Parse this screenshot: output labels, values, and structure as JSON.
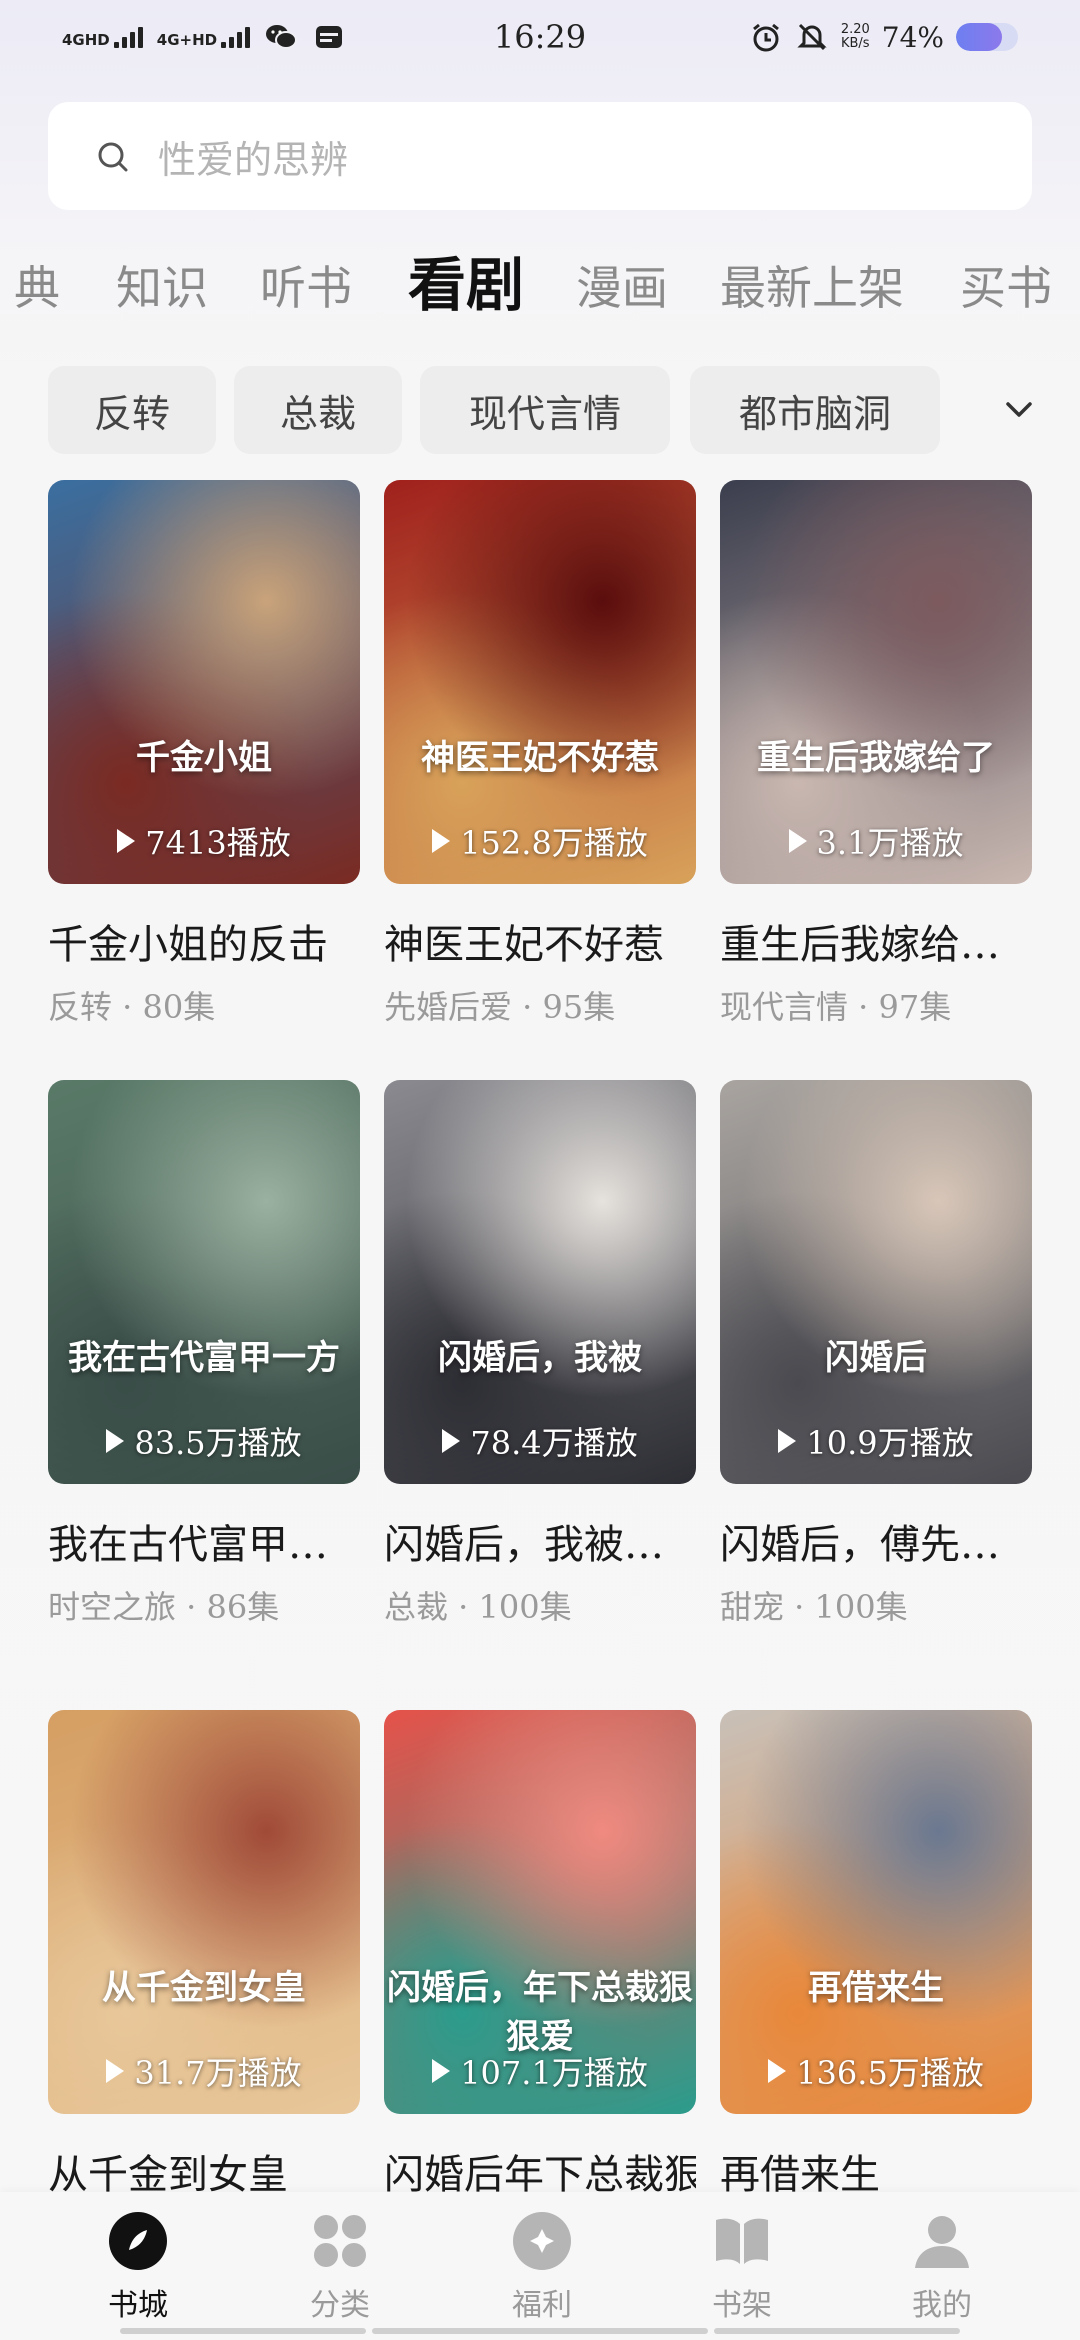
{
  "status_bar": {
    "time": "16:29",
    "network1": "4GHD",
    "network2": "4G+HD",
    "speed_value": "2.20",
    "speed_unit": "KB/s",
    "battery_percent": "74%",
    "battery_level": 0.74
  },
  "search": {
    "placeholder": "性爱的思辨"
  },
  "tabs": [
    {
      "label": "典"
    },
    {
      "label": "知识"
    },
    {
      "label": "听书"
    },
    {
      "label": "看剧",
      "active": true
    },
    {
      "label": "漫画"
    },
    {
      "label": "最新上架"
    },
    {
      "label": "买书"
    }
  ],
  "filters": [
    {
      "label": "反转"
    },
    {
      "label": "总裁"
    },
    {
      "label": "现代言情"
    },
    {
      "label": "都市脑洞"
    }
  ],
  "cards": [
    {
      "title": "千金小姐的反击",
      "meta": "反转 · 80集",
      "plays": "7413播放",
      "poster_text": "千金小姐",
      "colors": [
        "#3a6fa0",
        "#c9a37a",
        "#7a2a22"
      ]
    },
    {
      "title": "神医王妃不好惹",
      "meta": "先婚后爱 · 95集",
      "plays": "152.8万播放",
      "poster_text": "神医王妃不好惹",
      "colors": [
        "#a0201c",
        "#5a0d0d",
        "#d8a25a"
      ]
    },
    {
      "title": "重生后我嫁给…",
      "meta": "现代言情 · 97集",
      "plays": "3.1万播放",
      "poster_text": "重生后我嫁给了",
      "colors": [
        "#3b3e4e",
        "#7c5a5e",
        "#c9b7b0"
      ]
    },
    {
      "title": "我在古代富甲…",
      "meta": "时空之旅 · 86集",
      "plays": "83.5万播放",
      "poster_text": "我在古代富甲一方",
      "colors": [
        "#5a7a68",
        "#9ab0a0",
        "#3a4d48"
      ]
    },
    {
      "title": "闪婚后，我被…",
      "meta": "总裁 · 100集",
      "plays": "78.4万播放",
      "poster_text": "闪婚后，我被",
      "colors": [
        "#8a8a90",
        "#e6e2dd",
        "#2d2d34"
      ]
    },
    {
      "title": "闪婚后，傅先…",
      "meta": "甜宠 · 100集",
      "plays": "10.9万播放",
      "poster_text": "闪婚后",
      "colors": [
        "#a9a4a0",
        "#d8c6b8",
        "#4a4a50"
      ]
    },
    {
      "title": "从千金到女皇",
      "meta": "",
      "plays": "31.7万播放",
      "poster_text": "从千金到女皇",
      "colors": [
        "#d59e62",
        "#a04a38",
        "#e8c79a"
      ]
    },
    {
      "title": "闪婚后年下总裁狠狠爱",
      "meta": "",
      "plays": "107.1万播放",
      "poster_text": "闪婚后，年下总裁狠狠爱",
      "colors": [
        "#e5524a",
        "#f08a80",
        "#2b9c8c"
      ]
    },
    {
      "title": "再借来生",
      "meta": "",
      "plays": "136.5万播放",
      "poster_text": "再借来生",
      "colors": [
        "#c8c0b8",
        "#6a7890",
        "#e8883a"
      ]
    }
  ],
  "bottom_nav": [
    {
      "label": "书城",
      "icon": "bookstore-icon",
      "active": true
    },
    {
      "label": "分类",
      "icon": "category-icon"
    },
    {
      "label": "福利",
      "icon": "welfare-icon"
    },
    {
      "label": "书架",
      "icon": "bookshelf-icon"
    },
    {
      "label": "我的",
      "icon": "profile-icon"
    }
  ]
}
